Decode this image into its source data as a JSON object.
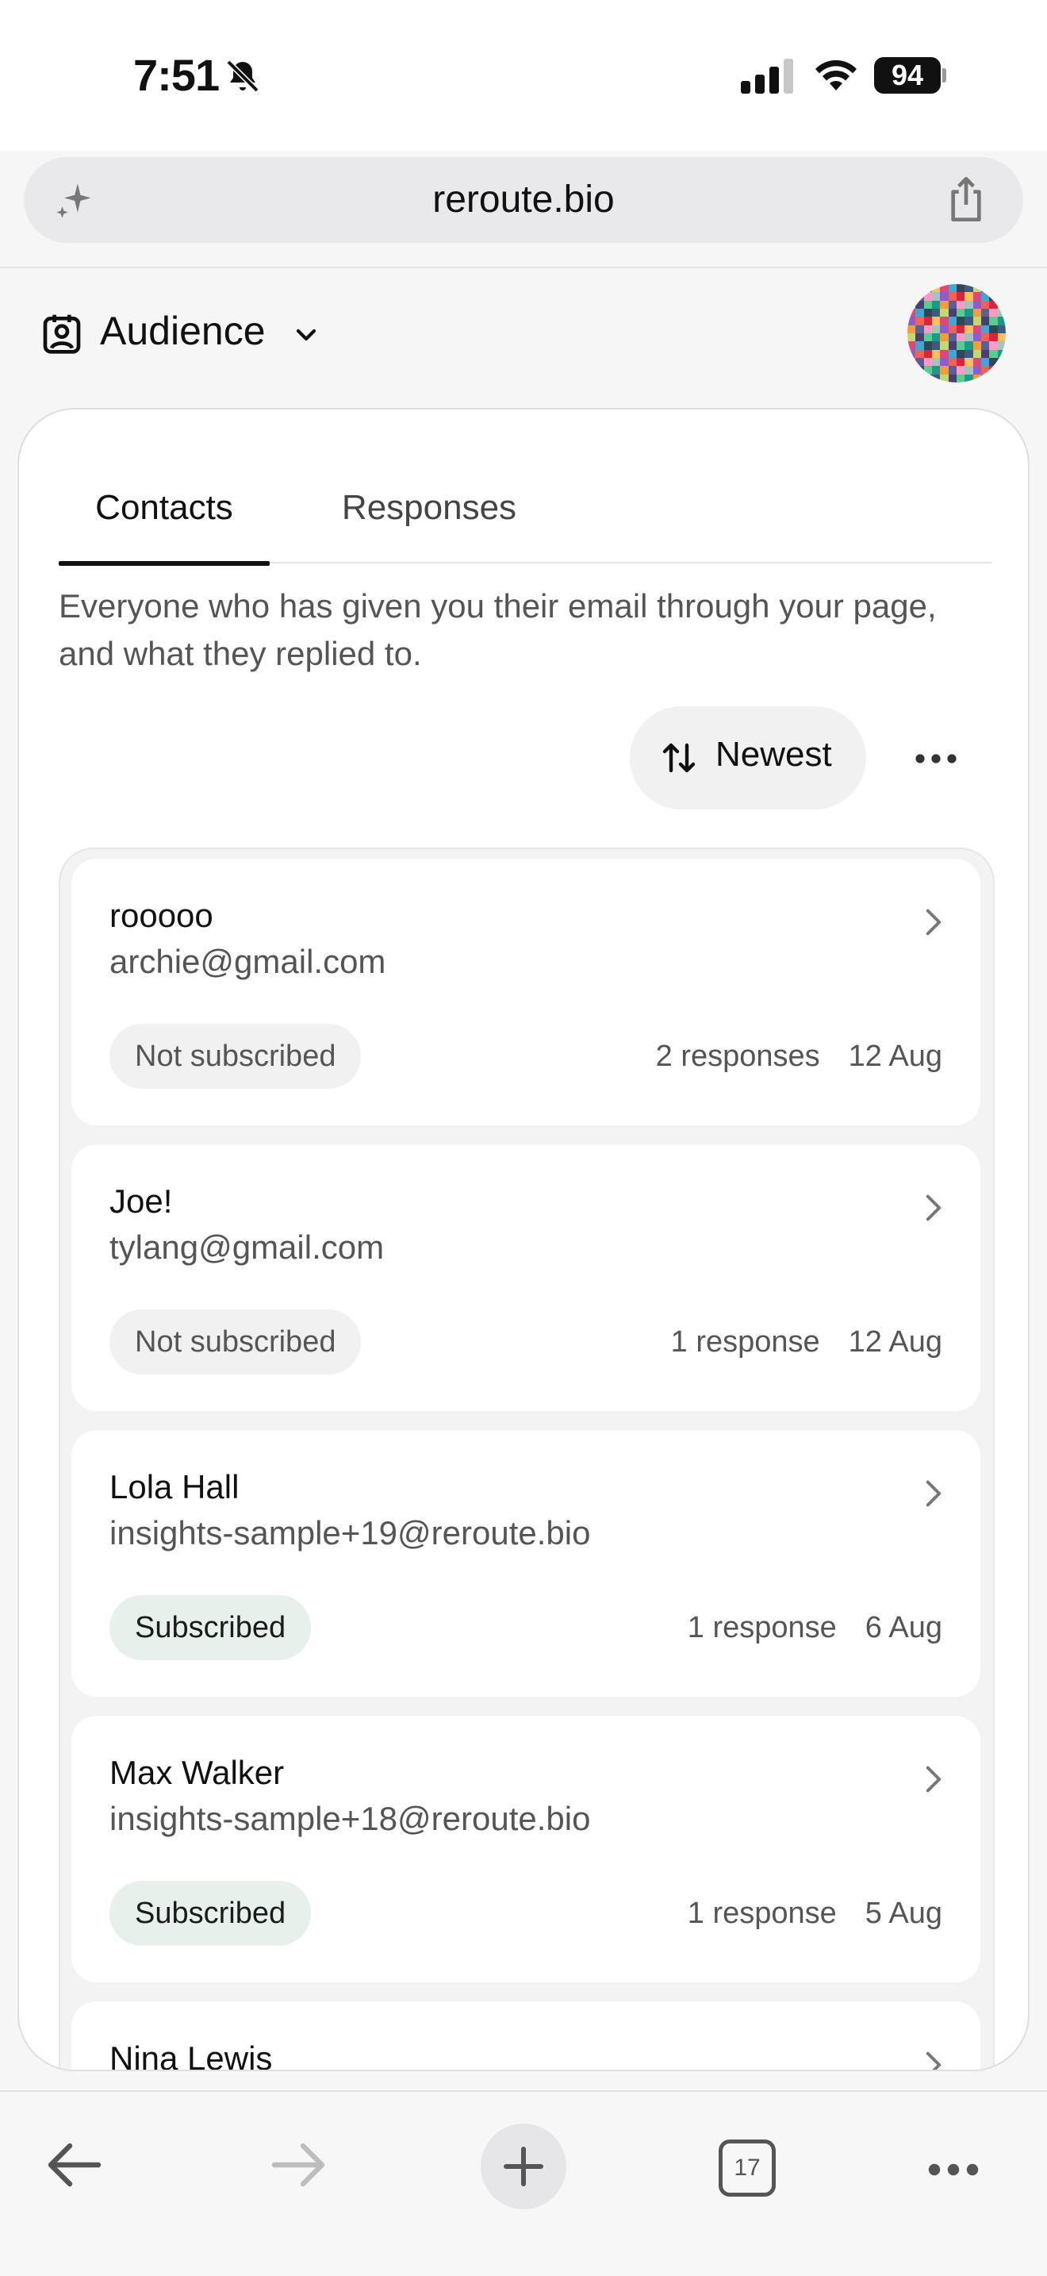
{
  "status_bar": {
    "time": "7:51",
    "battery": "94"
  },
  "browser": {
    "url": "reroute.bio",
    "tab_count": "17"
  },
  "header": {
    "title": "Audience"
  },
  "tabs": [
    {
      "label": "Contacts",
      "active": true
    },
    {
      "label": "Responses",
      "active": false
    }
  ],
  "intro": "Everyone who has given you their email through your page, and what they replied to.",
  "sort": {
    "label": "Newest"
  },
  "contacts": [
    {
      "name": "rooooo",
      "email": "archie@gmail.com",
      "status": "Not subscribed",
      "responses": "2 responses",
      "date": "12 Aug"
    },
    {
      "name": "Joe!",
      "email": "tylang@gmail.com",
      "status": "Not subscribed",
      "responses": "1 response",
      "date": "12 Aug"
    },
    {
      "name": "Lola Hall",
      "email": "insights-sample+19@reroute.bio",
      "status": "Subscribed",
      "responses": "1 response",
      "date": "6 Aug"
    },
    {
      "name": "Max Walker",
      "email": "insights-sample+18@reroute.bio",
      "status": "Subscribed",
      "responses": "1 response",
      "date": "5 Aug"
    },
    {
      "name": "Nina Lewis"
    }
  ],
  "colors": {
    "subscribed_badge": "#e5f1ea",
    "not_subscribed_badge": "#f1f1f1",
    "accent": "#111111"
  },
  "icons": [
    "bell-slash-icon",
    "signal-icon",
    "wifi-icon",
    "sparkle-icon",
    "share-icon",
    "contact-card-icon",
    "chevron-down-icon",
    "sort-arrows-icon",
    "more-icon",
    "chevron-right-icon",
    "back-arrow-icon",
    "forward-arrow-icon",
    "plus-icon",
    "tabs-icon"
  ]
}
